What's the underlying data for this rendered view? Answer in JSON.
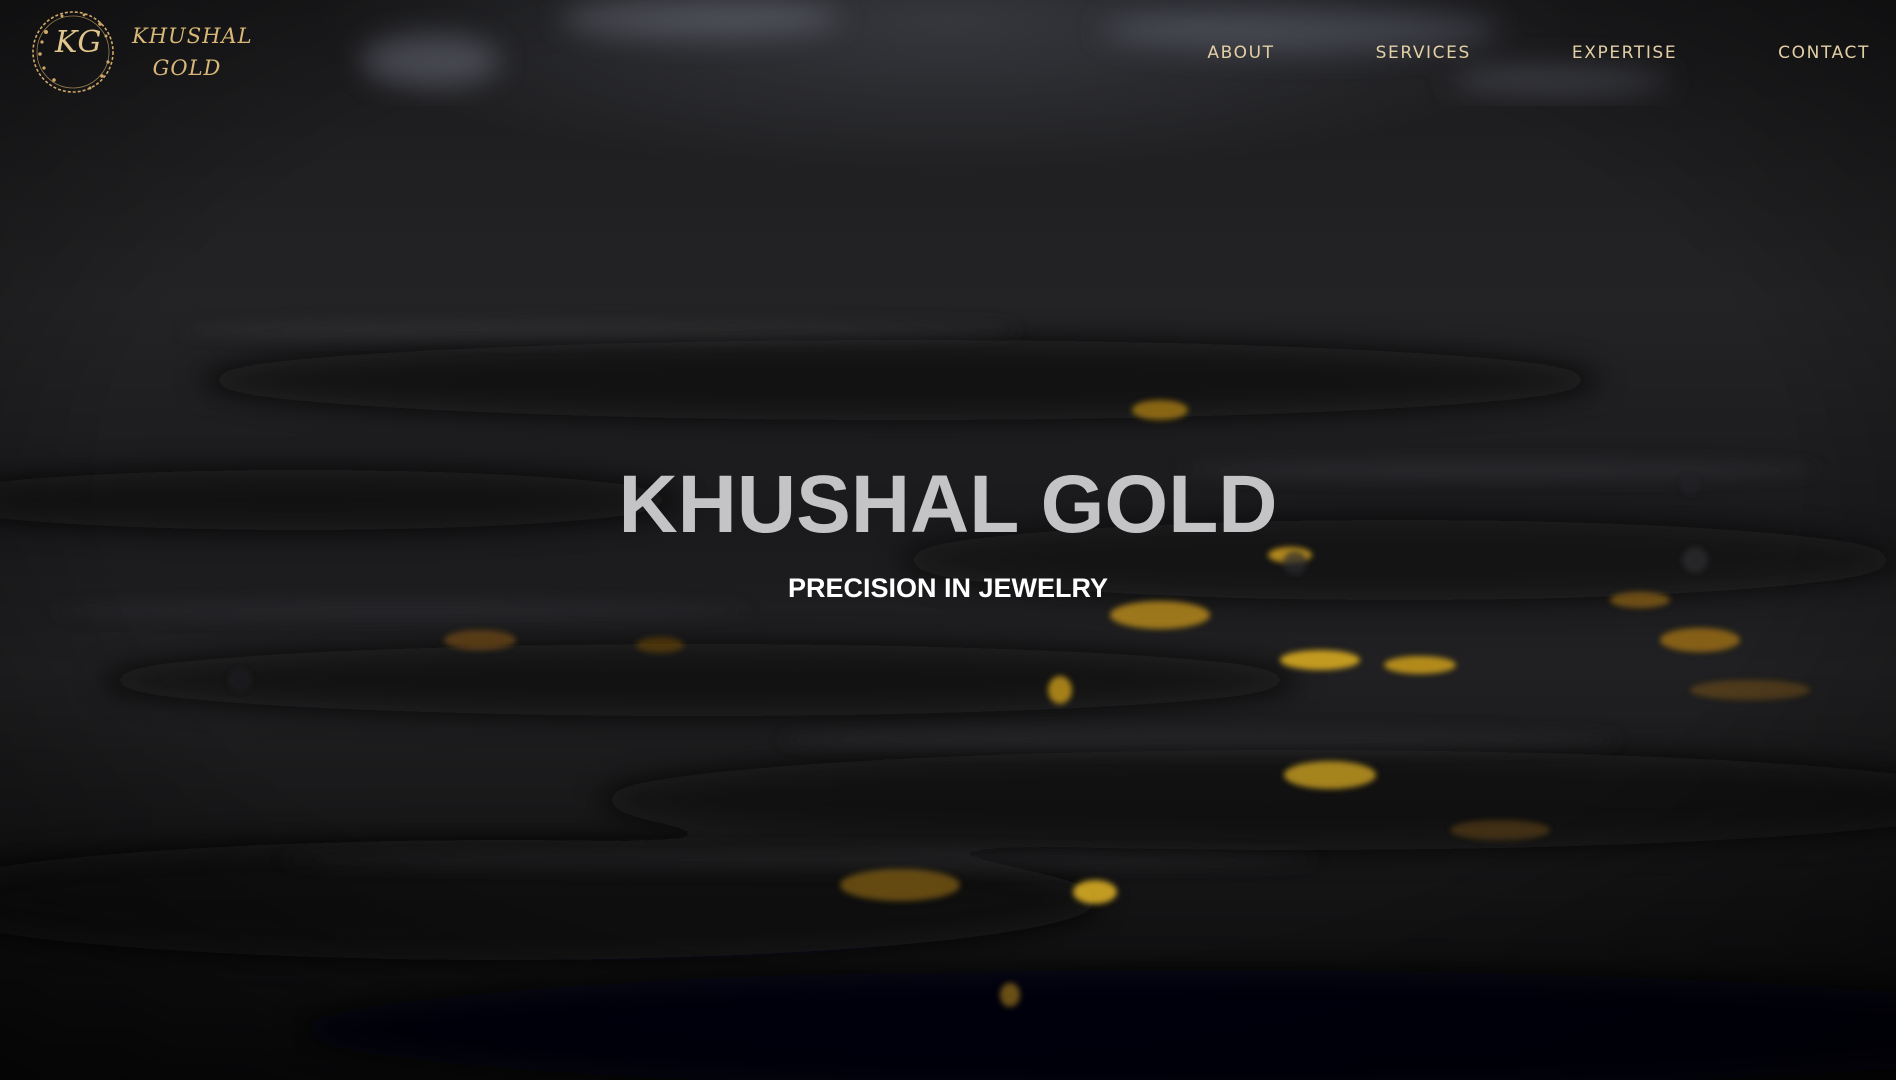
{
  "brand": {
    "logo_monogram": "KG",
    "logo_line1": "KHUSHAL",
    "logo_line2": "GOLD",
    "accent_color": "#d9b877"
  },
  "nav": {
    "items": [
      {
        "label": "ABOUT"
      },
      {
        "label": "SERVICES"
      },
      {
        "label": "EXPERTISE"
      },
      {
        "label": "CONTACT"
      }
    ]
  },
  "hero": {
    "title": "KHUSHAL GOLD",
    "subtitle": "PRECISION IN JEWELRY",
    "background": "dark-water-with-gold-reflections"
  }
}
